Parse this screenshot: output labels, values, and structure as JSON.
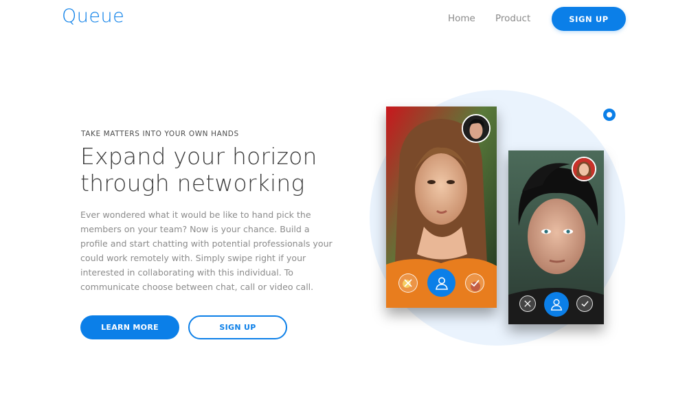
{
  "header": {
    "logo": "Queue",
    "nav": [
      {
        "label": "Home"
      },
      {
        "label": "Product"
      }
    ],
    "signup_label": "SIGN UP"
  },
  "hero": {
    "eyebrow": "TAKE MATTERS INTO YOUR OWN HANDS",
    "headline_line1": "Expand your horizon",
    "headline_line2": "through networking",
    "description": "Ever wondered what it would be like to hand pick the members on your team? Now is your chance. Build a profile and start chatting with potential professionals your could work remotely with. Simply swipe right if your interested in collaborating with this individual. To communicate choose between chat, call or video call.",
    "learn_more_label": "LEARN MORE",
    "signup_label": "SIGN UP"
  },
  "illustration": {
    "cards": [
      {
        "name": "profile-card-woman",
        "actions": [
          "close-icon",
          "user-icon",
          "check-icon"
        ]
      },
      {
        "name": "profile-card-man",
        "actions": [
          "close-icon",
          "user-icon",
          "check-icon"
        ]
      }
    ]
  },
  "colors": {
    "brand": "#0b7fe8",
    "circle_bg": "#eaf3fd",
    "text_dark": "#3a3a3a",
    "text_muted": "#8b8b8b"
  }
}
